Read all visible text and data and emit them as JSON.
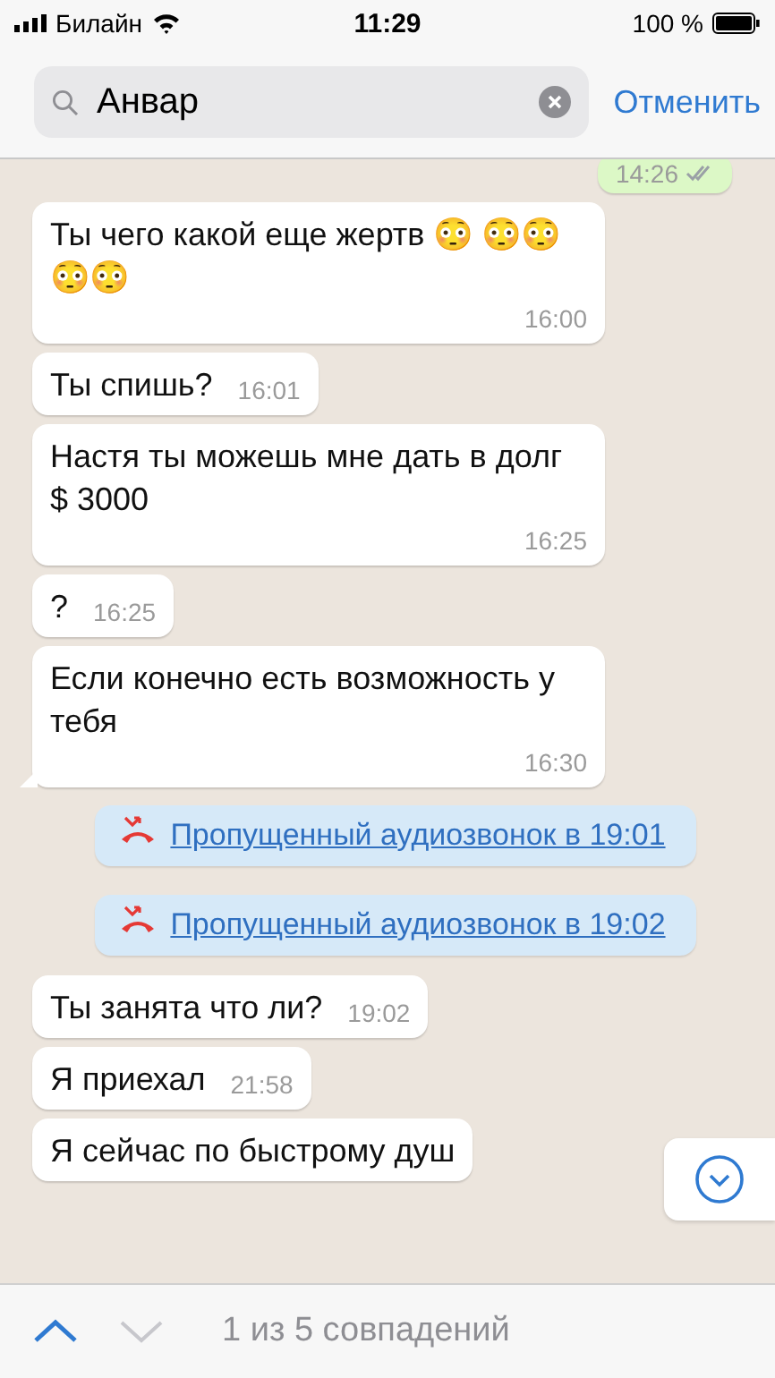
{
  "status_bar": {
    "carrier": "Билайн",
    "time": "11:29",
    "battery": "100 %"
  },
  "search": {
    "value": "Анвар",
    "cancel": "Отменить"
  },
  "messages": [
    {
      "kind": "outgoing",
      "time": "14:26",
      "read": true
    },
    {
      "kind": "incoming",
      "text": "Ты чего какой еще жертв 😳 😳😳😳😳",
      "time": "16:00"
    },
    {
      "kind": "incoming",
      "text": "Ты спишь?",
      "time": "16:01"
    },
    {
      "kind": "incoming",
      "text": "Настя ты можешь мне дать в долг $ 3000",
      "time": "16:25"
    },
    {
      "kind": "incoming",
      "text": "?",
      "time": "16:25"
    },
    {
      "kind": "incoming",
      "text": "Если конечно есть возможность у тебя",
      "time": "16:30",
      "tail": true
    },
    {
      "kind": "call",
      "text": "Пропущенный аудиозвонок в 19:01"
    },
    {
      "kind": "call",
      "text": "Пропущенный аудиозвонок в 19:02"
    },
    {
      "kind": "incoming",
      "text": "Ты занята что ли?",
      "time": "19:02"
    },
    {
      "kind": "incoming",
      "text": "Я приехал",
      "time": "21:58"
    },
    {
      "kind": "incoming",
      "text": "Я сейчас по быстрому душ"
    }
  ],
  "search_nav": {
    "up_enabled": true,
    "down_enabled": false,
    "count": "1 из 5 совпадений"
  }
}
